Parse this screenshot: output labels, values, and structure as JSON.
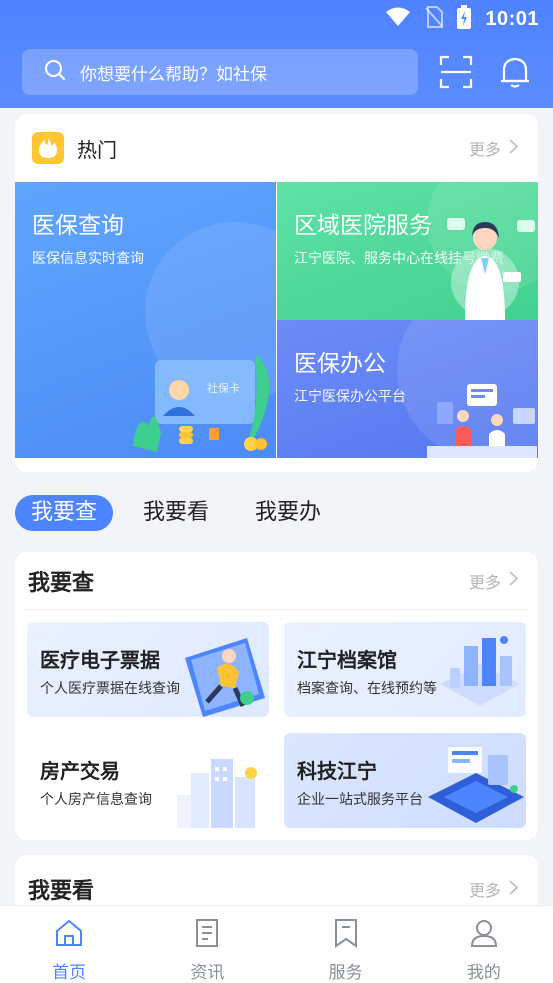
{
  "status_bar": {
    "time": "10:01"
  },
  "search": {
    "placeholder": "你想要什么帮助？如社保"
  },
  "hot": {
    "title": "热门",
    "more": "更多",
    "tiles": [
      {
        "title": "医保查询",
        "subtitle": "医保信息实时查询",
        "card_text": "社保卡"
      },
      {
        "title": "区域医院服务",
        "subtitle": "江宁医院、服务中心在线挂号缴费"
      },
      {
        "title": "医保办公",
        "subtitle": "江宁医保办公平台"
      }
    ]
  },
  "tabs": [
    {
      "label": "我要查",
      "active": true
    },
    {
      "label": "我要看",
      "active": false
    },
    {
      "label": "我要办",
      "active": false
    }
  ],
  "section_check": {
    "title": "我要查",
    "more": "更多",
    "items": [
      {
        "title": "医疗电子票据",
        "subtitle": "个人医疗票据在线查询"
      },
      {
        "title": "江宁档案馆",
        "subtitle": "档案查询、在线预约等"
      },
      {
        "title": "房产交易",
        "subtitle": "个人房产信息查询"
      },
      {
        "title": "科技江宁",
        "subtitle": "企业一站式服务平台"
      }
    ]
  },
  "section_view": {
    "title": "我要看",
    "more": "更多"
  },
  "bottom_nav": [
    {
      "label": "首页",
      "icon": "home-icon",
      "active": true
    },
    {
      "label": "资讯",
      "icon": "news-icon",
      "active": false
    },
    {
      "label": "服务",
      "icon": "bookmark-icon",
      "active": false
    },
    {
      "label": "我的",
      "icon": "user-icon",
      "active": false
    }
  ],
  "colors": {
    "primary": "#4d84ff",
    "hot_badge": "#ffc633",
    "green_tile": "#43d090"
  }
}
